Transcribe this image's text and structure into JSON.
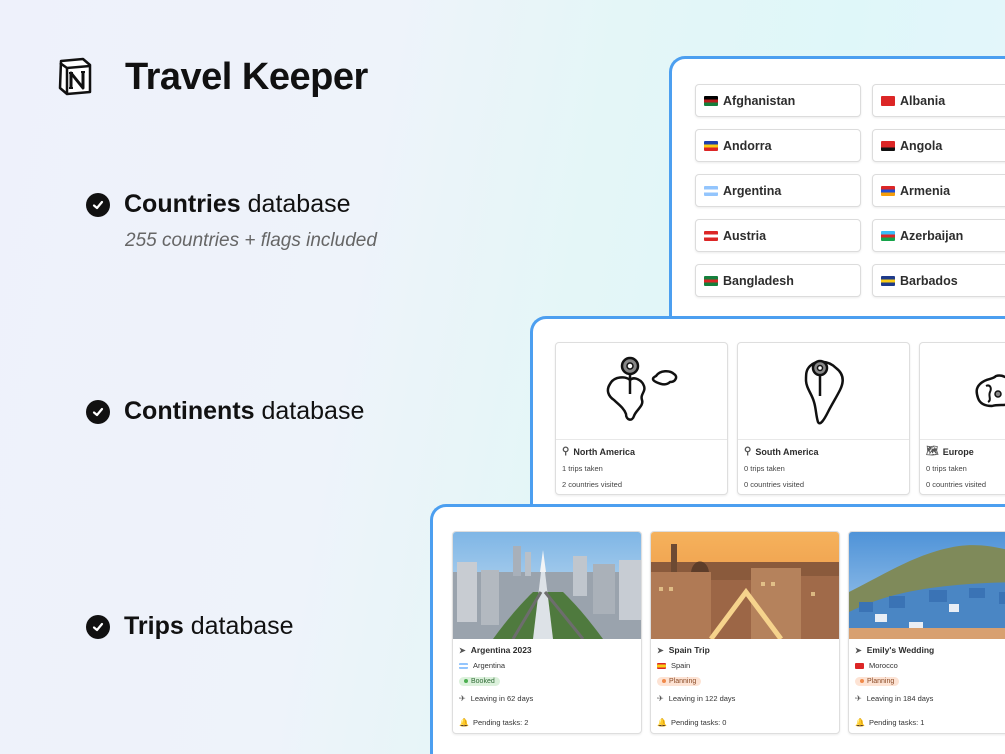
{
  "app": {
    "title": "Travel Keeper",
    "logo_icon": "notion-logo-icon"
  },
  "features": [
    {
      "bold": "Countries",
      "rest": " database",
      "sub": "255 countries + flags included"
    },
    {
      "bold": "Continents",
      "rest": " database"
    },
    {
      "bold": "Trips",
      "rest": " database"
    }
  ],
  "countries": [
    {
      "name": "Afghanistan",
      "flag": [
        "#000000",
        "#b91c1c",
        "#15803d"
      ]
    },
    {
      "name": "Albania",
      "flag": [
        "#dc2626",
        "#dc2626",
        "#dc2626"
      ]
    },
    {
      "name": "Andorra",
      "flag": [
        "#1e40af",
        "#facc15",
        "#dc2626"
      ]
    },
    {
      "name": "Angola",
      "flag": [
        "#dc2626",
        "#dc2626",
        "#111111"
      ]
    },
    {
      "name": "Argentina",
      "flag": [
        "#93c5fd",
        "#ffffff",
        "#93c5fd"
      ]
    },
    {
      "name": "Armenia",
      "flag": [
        "#dc2626",
        "#1d4ed8",
        "#f59e0b"
      ]
    },
    {
      "name": "Austria",
      "flag": [
        "#dc2626",
        "#ffffff",
        "#dc2626"
      ]
    },
    {
      "name": "Azerbaijan",
      "flag": [
        "#38bdf8",
        "#dc2626",
        "#16a34a"
      ]
    },
    {
      "name": "Bangladesh",
      "flag": [
        "#15803d",
        "#dc2626",
        "#15803d"
      ]
    },
    {
      "name": "Barbados",
      "flag": [
        "#1e3a8a",
        "#facc15",
        "#1e3a8a"
      ]
    }
  ],
  "continents": [
    {
      "name": "North America",
      "icon": "map-pin-icon",
      "trips": "1 trips taken",
      "countries": "2 countries visited"
    },
    {
      "name": "South America",
      "icon": "map-pin-icon",
      "trips": "0 trips taken",
      "countries": "0 countries visited"
    },
    {
      "name": "Europe",
      "icon": "map-icon",
      "trips": "0 trips taken",
      "countries": "0 countries visited"
    }
  ],
  "trips": [
    {
      "name": "Argentina 2023",
      "country": "Argentina",
      "status": "Booked",
      "leaving": "Leaving in 62 days",
      "pending": "Pending tasks: 2",
      "flag": [
        "#93c5fd",
        "#ffffff",
        "#93c5fd"
      ]
    },
    {
      "name": "Spain Trip",
      "country": "Spain",
      "status": "Planning",
      "leaving": "Leaving in 122 days",
      "pending": "Pending tasks: 0",
      "flag": [
        "#dc2626",
        "#facc15",
        "#dc2626"
      ]
    },
    {
      "name": "Emily's Wedding",
      "country": "Morocco",
      "status": "Planning",
      "leaving": "Leaving in 184 days",
      "pending": "Pending tasks: 1",
      "flag": [
        "#dc2626",
        "#dc2626",
        "#dc2626"
      ]
    }
  ],
  "colors": {
    "accent_border": "#4c9ff0",
    "booked_bg": "#dcf1dc",
    "booked_fg": "#2f6b35",
    "booked_dot": "#4caf50",
    "planning_bg": "#fde3d4",
    "planning_fg": "#8a4a26",
    "planning_dot": "#f08a4b"
  }
}
